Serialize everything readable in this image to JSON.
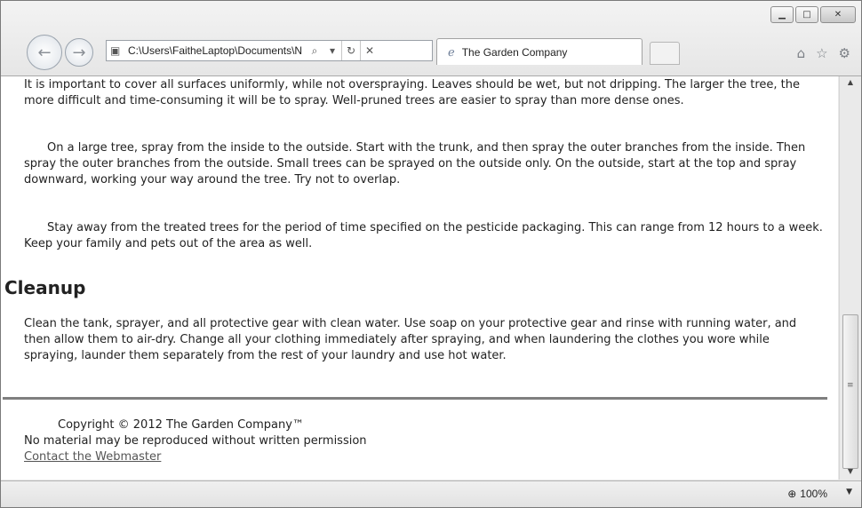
{
  "browser": {
    "address_url": "C:\\Users\\FaitheLaptop\\Documents\\N",
    "tab_title": "The Garden Company",
    "zoom": "100%"
  },
  "content": {
    "paragraph1": "It is important to cover all surfaces uniformly, while not overspraying. Leaves should be wet, but not dripping. The larger the tree, the more difficult and time-consuming it will be to spray. Well-pruned trees are easier to spray than more dense ones.",
    "paragraph2": "On a large tree, spray from the inside to the outside. Start with the trunk, and then spray the outer branches from the inside. Then spray the outer branches from the outside. Small trees can be sprayed on the outside only. On the outside, start at the top and spray downward, working your way around the tree. Try not to overlap.",
    "paragraph3": "Stay away from the treated trees for the period of time specified on the pesticide packaging. This can range from 12 hours to a week. Keep your family and pets out of the area as well.",
    "heading": "Cleanup",
    "paragraph4": "Clean the tank, sprayer, and all protective gear with clean water. Use soap on your protective gear and rinse with running water, and then allow them to air-dry. Change all your clothing immediately after spraying, and when laundering the clothes you wore while spraying, launder them separately from the rest of your laundry and use hot water."
  },
  "footer": {
    "copyright": "Copyright © 2012 The Garden Company™",
    "notice": "No material may be reproduced without written permission",
    "link": "Contact the Webmaster"
  },
  "icons": {
    "minimize": "minimize-icon",
    "maximize": "maximize-icon",
    "close": "close-icon",
    "back": "back-arrow-icon",
    "forward": "forward-arrow-icon",
    "page": "page-icon",
    "search": "search-icon",
    "refresh": "refresh-icon",
    "stop": "stop-icon",
    "home": "home-icon",
    "favorites": "star-icon",
    "tools": "gear-icon",
    "zoom": "zoom-icon"
  }
}
